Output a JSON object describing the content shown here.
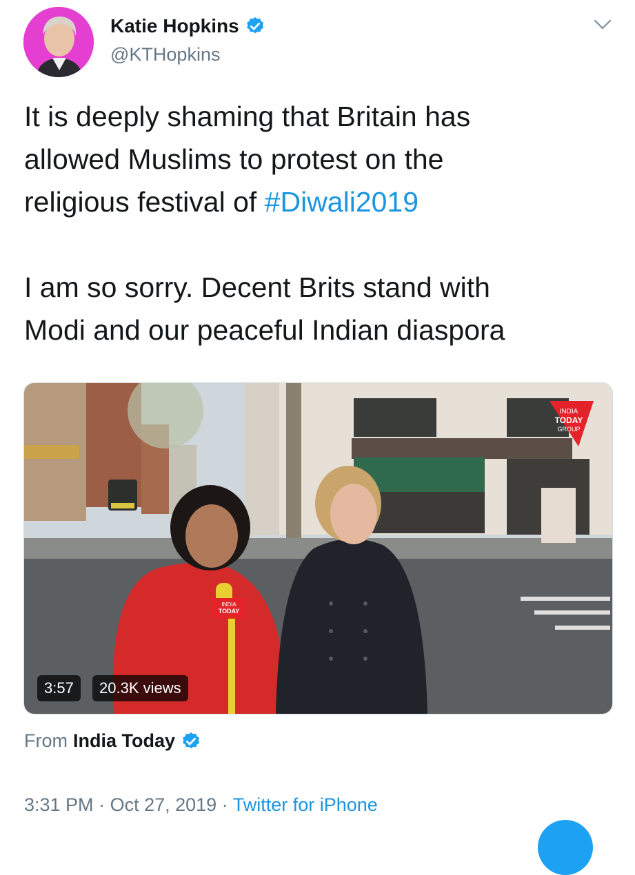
{
  "author": {
    "name": "Katie Hopkins",
    "handle": "@KTHopkins",
    "verified_icon": "verified-badge-icon",
    "avatar_bg": "#e43fd0"
  },
  "menu_icon": "chevron-down-icon",
  "tweet": {
    "line1": "It is deeply shaming that Britain has",
    "line2": "allowed Muslims to protest on the",
    "line3_prefix": "religious festival of ",
    "hashtag": "#Diwali2019",
    "line4": "I am so sorry. Decent Brits stand with",
    "line5": "Modi and our peaceful Indian diaspora"
  },
  "video": {
    "duration": "3:57",
    "views": "20.3K views",
    "watermark_line1": "INDIA",
    "watermark_line2": "TODAY",
    "watermark_line3": "GROUP",
    "mic_flag_line1": "INDIA",
    "mic_flag_line2": "TODAY"
  },
  "source": {
    "from_label": "From",
    "name": "India Today"
  },
  "meta": {
    "time": "3:31 PM",
    "separator": " · ",
    "date": "Oct 27, 2019",
    "client": "Twitter for iPhone"
  },
  "colors": {
    "link": "#1b95e0",
    "secondary_text": "#657786",
    "primary_text": "#14171a",
    "verified": "#1da1f2"
  }
}
